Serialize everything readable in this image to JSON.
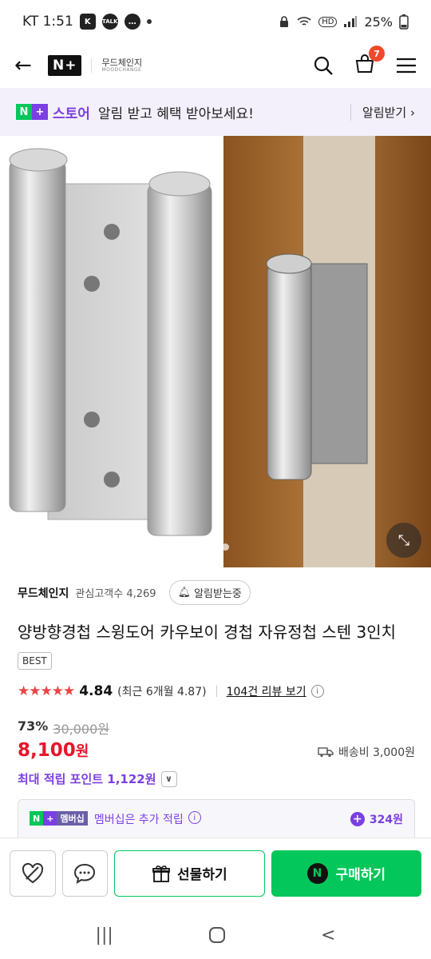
{
  "status_bar": {
    "carrier_time": "KT 1:51",
    "battery": "25%"
  },
  "header": {
    "nplus_label": "N+",
    "brand_korean": "무드체인지",
    "brand_english": "MOODCHANGE",
    "cart_count": "7"
  },
  "promo": {
    "store_label": "스토어",
    "message": "알림 받고 혜택 받아보세요!",
    "action_label": "알림받기 ›"
  },
  "gallery": {
    "page_dots": 3,
    "active_index": 0
  },
  "seller": {
    "name": "무드체인지",
    "fans_label": "관심고객수 4,269",
    "notify_label": "알림받는중"
  },
  "product": {
    "title": "양방향경첩 스윙도어 카우보이 경첩 자유정첩 스텐 3인치",
    "best_badge": "BEST",
    "stars": "★★★★★",
    "score": "4.84",
    "recent_score": "(최근 6개월 4.87)",
    "reviews_label": "104건 리뷰 보기",
    "discount_pct": "73%",
    "original_price": "30,000원",
    "price": "8,100",
    "price_unit": "원",
    "shipping": "배송비 3,000원",
    "max_points": "최대 적립 포인트 1,122원"
  },
  "membership": {
    "badge_n": "N",
    "badge_plus": "+",
    "badge_label": "멤버십",
    "text": "멤버십은 추가 적립",
    "points": "324원"
  },
  "bottom_bar": {
    "gift_label": "선물하기",
    "buy_label": "구매하기",
    "npay_icon": "N"
  },
  "colors": {
    "naver_green": "#03c75a",
    "plus_purple": "#7b3fe4",
    "price_red": "#e8152b",
    "star_red": "#e84545"
  }
}
